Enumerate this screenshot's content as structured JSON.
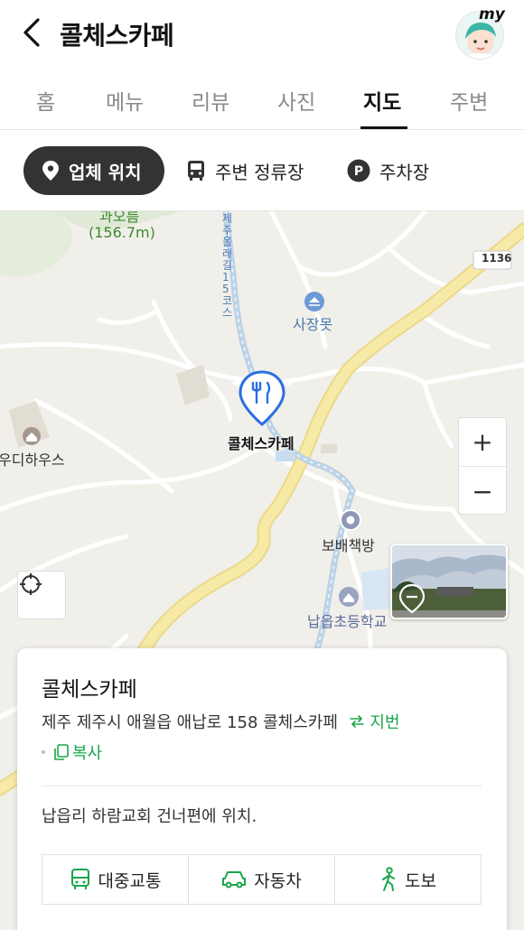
{
  "header": {
    "title": "콜체스카페",
    "avatar_badge": "my"
  },
  "tabs": [
    {
      "label": "홈"
    },
    {
      "label": "메뉴"
    },
    {
      "label": "리뷰"
    },
    {
      "label": "사진"
    },
    {
      "label": "지도",
      "active": true
    },
    {
      "label": "주변"
    }
  ],
  "filters": [
    {
      "label": "업체 위치",
      "icon": "map-pin-icon",
      "active": true
    },
    {
      "label": "주변 정류장",
      "icon": "bus-icon"
    },
    {
      "label": "주차장",
      "icon": "parking-icon"
    }
  ],
  "map": {
    "labels": {
      "oreum_name": "과오름",
      "oreum_height": "(156.7m)",
      "route_vertical": "제주올레길15코스",
      "road_number": "1136",
      "pond": "사장못",
      "guesthouse": "우디하우스",
      "cafe": "콜체스카페",
      "bookstore": "보배책방",
      "school": "납읍초등학교"
    },
    "controls": {
      "zoom_in": "+",
      "zoom_out": "−"
    }
  },
  "card": {
    "title": "콜체스카페",
    "address": "제주 제주시 애월읍 애납로 158 콜체스카페",
    "jibun_link": "지번",
    "copy_label": "복사",
    "description": "납읍리 하람교회 건너편에 위치.",
    "modes": [
      {
        "label": "대중교통",
        "icon": "bus-icon"
      },
      {
        "label": "자동차",
        "icon": "car-icon"
      },
      {
        "label": "도보",
        "icon": "walk-icon"
      }
    ]
  },
  "colors": {
    "accent_green": "#1aa64b",
    "pin_blue": "#2b6fe0",
    "road_yellow": "#f5e08a"
  }
}
